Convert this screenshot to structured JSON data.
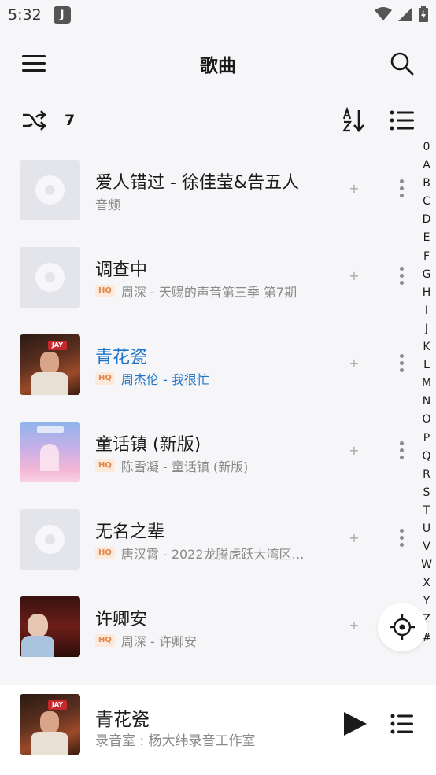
{
  "status_bar": {
    "time": "5:32",
    "app_badge": "J"
  },
  "header": {
    "title": "歌曲"
  },
  "toolbar": {
    "count": "7"
  },
  "songs": [
    {
      "title": "爱人错过 - 徐佳莹&告五人",
      "hq": false,
      "subtitle": "音频",
      "cover": "placeholder",
      "active": false
    },
    {
      "title": "调查中",
      "hq": true,
      "subtitle": "周深 - 天赐的声音第三季 第7期",
      "cover": "placeholder",
      "active": false
    },
    {
      "title": "青花瓷",
      "hq": true,
      "subtitle": "周杰伦 - 我很忙",
      "cover": "jay",
      "active": true
    },
    {
      "title": "童话镇 (新版)",
      "hq": true,
      "subtitle": "陈雪凝 - 童话镇 (新版)",
      "cover": "fairy",
      "active": false
    },
    {
      "title": "无名之辈",
      "hq": true,
      "subtitle": "唐汉霄 - 2022龙腾虎跃大湾区…",
      "cover": "placeholder",
      "active": false
    },
    {
      "title": "许卿安",
      "hq": true,
      "subtitle": "周深 - 许卿安",
      "cover": "xu",
      "active": false
    }
  ],
  "hq_label": "HQ",
  "add_glyph": "+",
  "alphabet": [
    "0",
    "A",
    "B",
    "C",
    "D",
    "E",
    "F",
    "G",
    "H",
    "I",
    "J",
    "K",
    "L",
    "M",
    "N",
    "O",
    "P",
    "Q",
    "R",
    "S",
    "T",
    "U",
    "V",
    "W",
    "X",
    "Y",
    "Z",
    "#"
  ],
  "player": {
    "title": "青花瓷",
    "subtitle": "录音室 : 杨大纬录音工作室"
  },
  "colors": {
    "accent": "#1f74c8",
    "background": "#f6f6f8",
    "hq_badge": "#e2884b"
  }
}
